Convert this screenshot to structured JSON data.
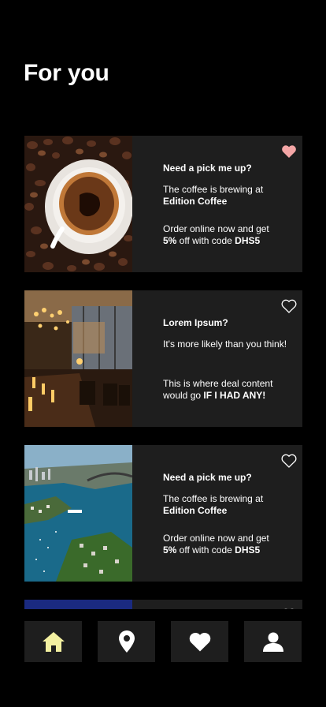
{
  "header": {
    "title": "For you"
  },
  "cards": [
    {
      "heading": "Need a pick me up?",
      "line1_text": "The coffee is brewing at",
      "line1_bold": "Edition Coffee",
      "line2_text": "Order online now and get",
      "line2_bold_a": "5%",
      "line2_mid": " off with code ",
      "line2_bold_b": "DHS5",
      "image": "coffee-cup-photo",
      "favorited": true
    },
    {
      "heading": "Lorem Ipsum?",
      "line1_text": "It's more likely than you think!",
      "line2_text": "This is where deal content would go ",
      "line2_bold": "IF I HAD ANY!",
      "image": "restaurant-interior-photo",
      "favorited": false
    },
    {
      "heading": "Need a pick me up?",
      "line1_text": "The coffee is brewing at",
      "line1_bold": "Edition Coffee",
      "line2_text": "Order online now and get",
      "line2_bold_a": "5%",
      "line2_mid": " off with code ",
      "line2_bold_b": "DHS5",
      "image": "sydney-harbour-photo",
      "favorited": false
    }
  ],
  "tabs": [
    {
      "icon": "home-icon",
      "active": true
    },
    {
      "icon": "location-pin-icon",
      "active": false
    },
    {
      "icon": "heart-icon",
      "active": false
    },
    {
      "icon": "user-icon",
      "active": false
    }
  ],
  "colors": {
    "background": "#000000",
    "card": "#1e1e1e",
    "favorite_active": "#f4a6a6",
    "tab_active": "#f3f0a0",
    "text": "#ffffff"
  }
}
